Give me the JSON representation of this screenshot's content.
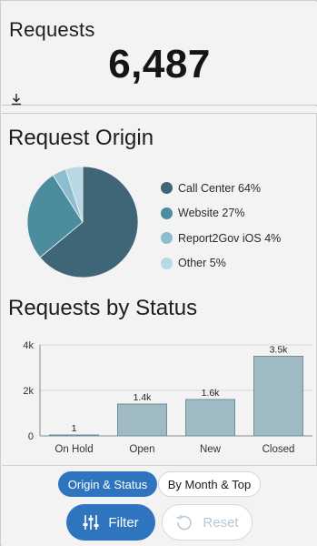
{
  "requests": {
    "title": "Requests",
    "value": "6,487",
    "download_icon": "download-icon"
  },
  "origin": {
    "title": "Request Origin",
    "legend": [
      {
        "label": "Call Center",
        "percent_label": "64%",
        "color": "#3e6677"
      },
      {
        "label": "Website",
        "percent_label": "27%",
        "color": "#4c8c9f"
      },
      {
        "label": "Report2Gov iOS",
        "percent_label": "4%",
        "color": "#8cbdd0"
      },
      {
        "label": "Other",
        "percent_label": "5%",
        "color": "#b8d8e3"
      }
    ]
  },
  "status": {
    "title": "Requests by Status"
  },
  "chart_data": [
    {
      "type": "pie",
      "title": "Request Origin",
      "labels": [
        "Call Center",
        "Website",
        "Report2Gov iOS",
        "Other"
      ],
      "values": [
        64,
        27,
        4,
        5
      ],
      "colors": [
        "#3e6677",
        "#4c8c9f",
        "#8cbdd0",
        "#b8d8e3"
      ],
      "legend": "right"
    },
    {
      "type": "bar",
      "title": "Requests by Status",
      "categories": [
        "On Hold",
        "Open",
        "New",
        "Closed"
      ],
      "values": [
        1,
        1400,
        1600,
        3500
      ],
      "data_labels": [
        "1",
        "1.4k",
        "1.6k",
        "3.5k"
      ],
      "ylim": [
        0,
        4000
      ],
      "yticks": [
        0,
        2000,
        4000
      ],
      "ytick_labels": [
        "0",
        "2k",
        "4k"
      ],
      "grid": true,
      "bar_color": "#9fbac3",
      "bar_stroke": "#6e8f9c"
    }
  ],
  "toolbar": {
    "tab_origin_status": "Origin & Status",
    "tab_month_top": "By Month & Top",
    "filter_label": "Filter",
    "reset_label": "Reset",
    "filter_icon": "sliders-icon",
    "reset_icon": "reset-icon",
    "accent": "#2f74bf"
  }
}
